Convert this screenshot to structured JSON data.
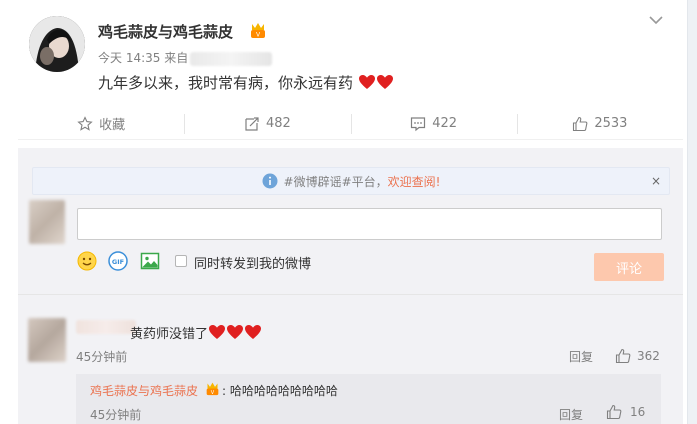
{
  "post": {
    "author": "鸡毛蒜皮与鸡毛蒜皮",
    "time": "今天 14:35",
    "source_prefix": "来自",
    "text": "九年多以来，我时常有病，你永远有药"
  },
  "actions": {
    "favorite": "收藏",
    "repost_count": "482",
    "comment_count": "422",
    "like_count": "2533"
  },
  "comment_box": {
    "notice_prefix": "#微博辟谣#平台，",
    "notice_link": "欢迎查阅!",
    "notice_close": "×",
    "repost_label": "同时转发到我的微博",
    "submit_label": "评论",
    "input_placeholder": ""
  },
  "comments": [
    {
      "text": "黄药师没错了",
      "time": "45分钟前",
      "reply_label": "回复",
      "likes": "362",
      "subreply": {
        "author": "鸡毛蒜皮与鸡毛蒜皮",
        "separator": ":",
        "text": "哈哈哈哈哈哈哈哈哈",
        "time": "45分钟前",
        "reply_label": "回复",
        "likes": "16"
      }
    }
  ],
  "colors": {
    "link": "#eb7350",
    "muted": "#808080",
    "submit_disabled": "#fdc8ad",
    "heart": "#e02020"
  }
}
